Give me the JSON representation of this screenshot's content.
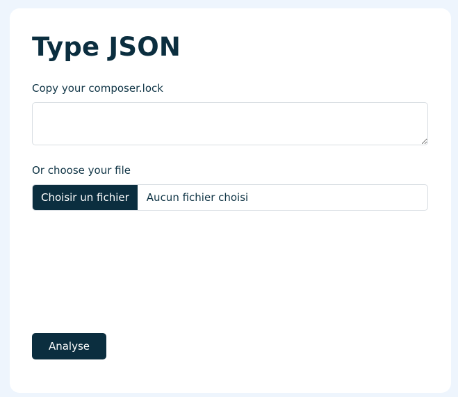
{
  "form": {
    "title": "Type JSON",
    "text_label": "Copy your composer.lock",
    "text_value": "",
    "file_label": "Or choose your file",
    "file_button_label": "Choisir un fichier",
    "file_status": "Aucun fichier choisi",
    "submit_label": "Analyse"
  },
  "colors": {
    "page_background": "#eef5fd",
    "card_background": "#ffffff",
    "primary": "#0b2e3f",
    "border": "#d8dde2"
  }
}
